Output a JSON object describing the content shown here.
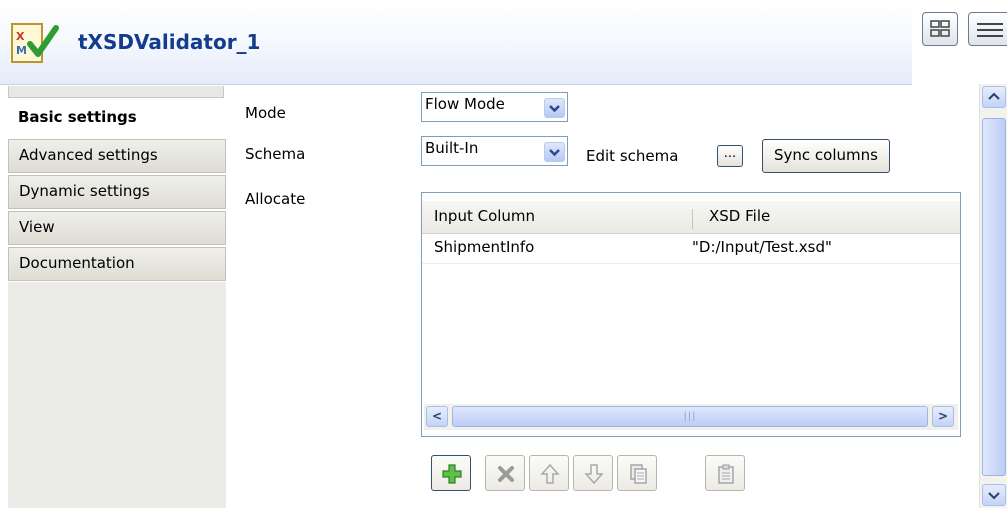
{
  "header": {
    "title": "tXSDValidator_1"
  },
  "sidebar": {
    "tabs": [
      {
        "label": "Basic settings",
        "active": true
      },
      {
        "label": "Advanced settings",
        "active": false
      },
      {
        "label": "Dynamic settings",
        "active": false
      },
      {
        "label": "View",
        "active": false
      },
      {
        "label": "Documentation",
        "active": false
      }
    ]
  },
  "form": {
    "mode_label": "Mode",
    "mode_value": "Flow Mode",
    "schema_label": "Schema",
    "schema_value": "Built-In",
    "edit_schema_label": "Edit schema",
    "edit_schema_button": "...",
    "sync_columns_button": "Sync columns",
    "allocate_label": "Allocate"
  },
  "table": {
    "columns": [
      "Input Column",
      "XSD File"
    ],
    "rows": [
      {
        "input_column": "ShipmentInfo",
        "xsd_file": "\"D:/Input/Test.xsd\""
      }
    ]
  },
  "toolbar": {
    "buttons": [
      {
        "icon": "add-icon",
        "enabled": true
      },
      {
        "icon": "remove-icon",
        "enabled": false
      },
      {
        "icon": "move-up-icon",
        "enabled": false
      },
      {
        "icon": "move-down-icon",
        "enabled": false
      },
      {
        "icon": "copy-icon",
        "enabled": false
      },
      {
        "icon": "paste-icon",
        "enabled": false
      }
    ]
  },
  "colors": {
    "title": "#143c8c",
    "add_green": "#3fa82f",
    "accent_border": "#35506f"
  }
}
